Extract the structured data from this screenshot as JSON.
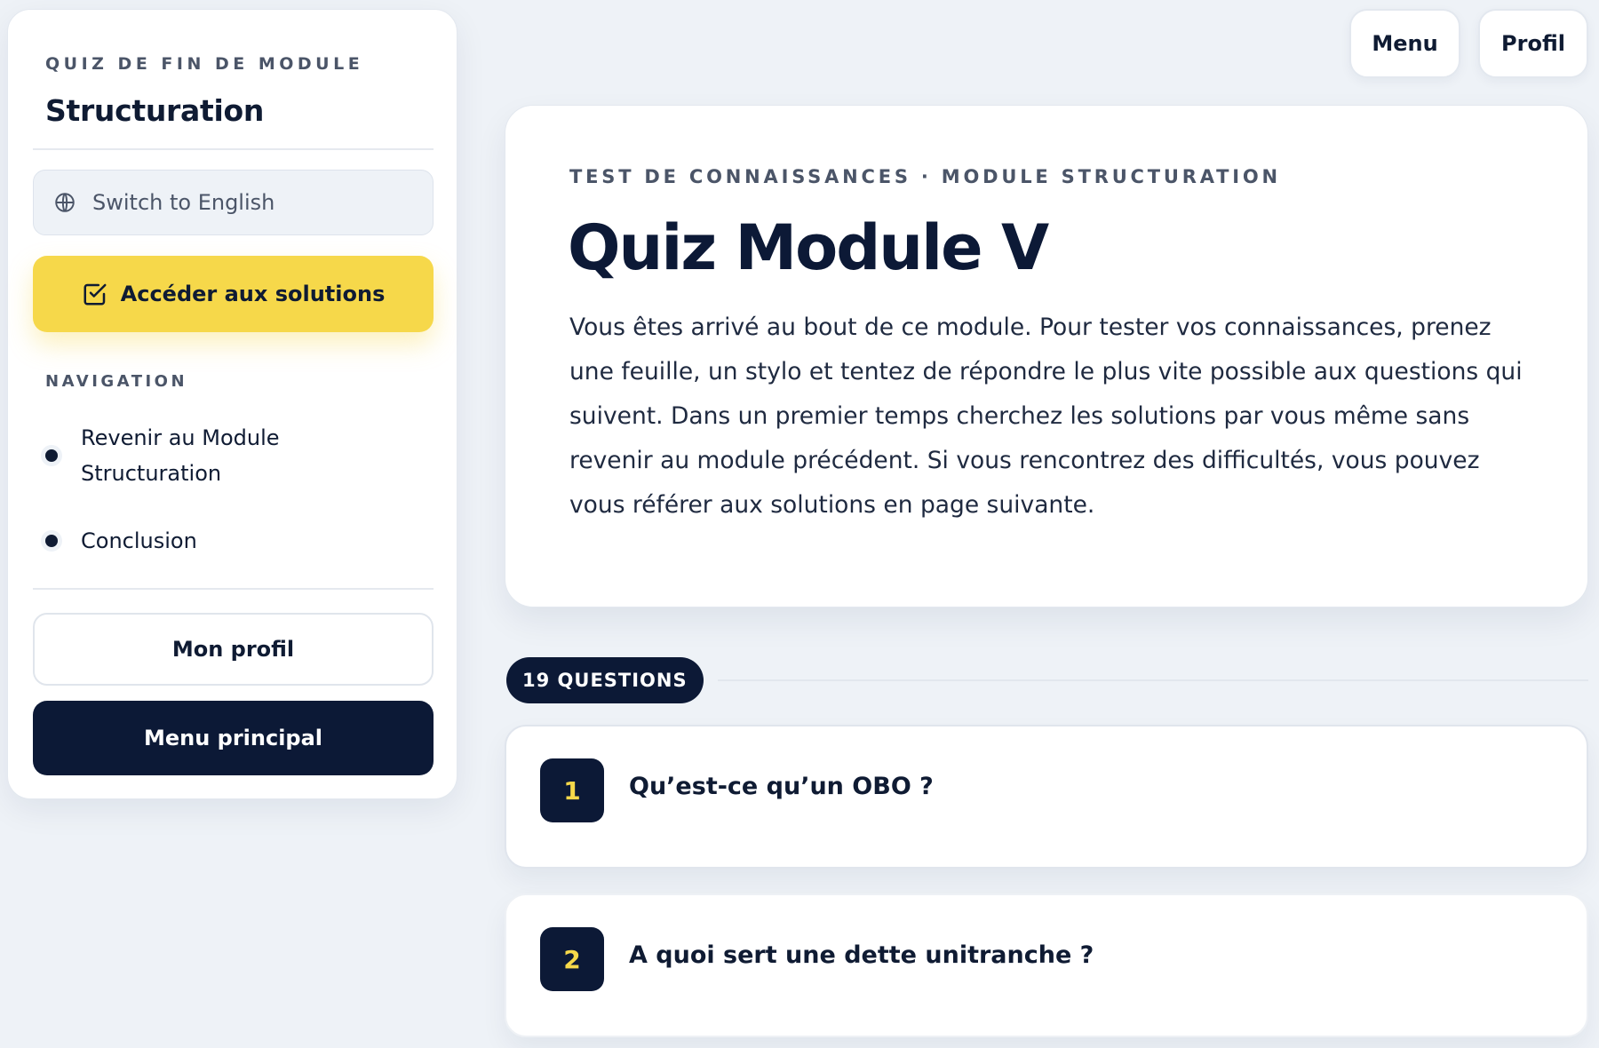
{
  "sidebar": {
    "eyebrow": "QUIZ DE FIN DE MODULE",
    "title": "Structuration",
    "language_button": {
      "label": "Switch to English",
      "icon": "globe-icon"
    },
    "solutions_button": {
      "label": "Accéder aux solutions",
      "icon": "checkbox-edit-icon"
    },
    "navigation": {
      "heading": "NAVIGATION",
      "items": [
        {
          "label": "Revenir au Module Structuration"
        },
        {
          "label": "Conclusion"
        }
      ]
    },
    "profile_button": "Mon profil",
    "main_menu_button": "Menu principal"
  },
  "top_bar": {
    "menu_button": "Menu",
    "profile_button": "Profil"
  },
  "hero": {
    "eyebrow": "TEST DE CONNAISSANCES · MODULE STRUCTURATION",
    "title": "Quiz Module V",
    "description": "Vous êtes arrivé au bout de ce module. Pour tester vos connaissances, prenez une feuille, un stylo et tentez de répondre le plus vite possible aux questions qui suivent. Dans un premier temps cherchez les solutions par vous même sans revenir au module précédent. Si vous rencontrez des difficultés, vous pouvez vous référer aux solutions en page suivante."
  },
  "questions": {
    "badge": "19 QUESTIONS",
    "items": [
      {
        "number": "1",
        "text": "Qu’est-ce qu’un OBO ?"
      },
      {
        "number": "2",
        "text": "A quoi sert une dette unitranche ?"
      }
    ]
  },
  "colors": {
    "navy": "#0c1936",
    "accent_yellow": "#f6d84a",
    "background": "#eef2f7",
    "muted_text": "#4b5568"
  }
}
